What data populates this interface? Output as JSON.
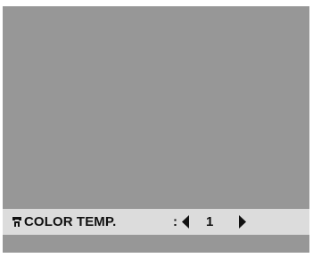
{
  "menu": {
    "item_icon": "wrench-icon",
    "item_label": "COLOR TEMP.",
    "separator": ":",
    "value": "1",
    "left_arrow_icon": "arrow-left-icon",
    "right_arrow_icon": "arrow-right-icon"
  },
  "colors": {
    "screen_background": "#979797",
    "menu_bar_background": "#dcdcdc",
    "text": "#111111"
  }
}
